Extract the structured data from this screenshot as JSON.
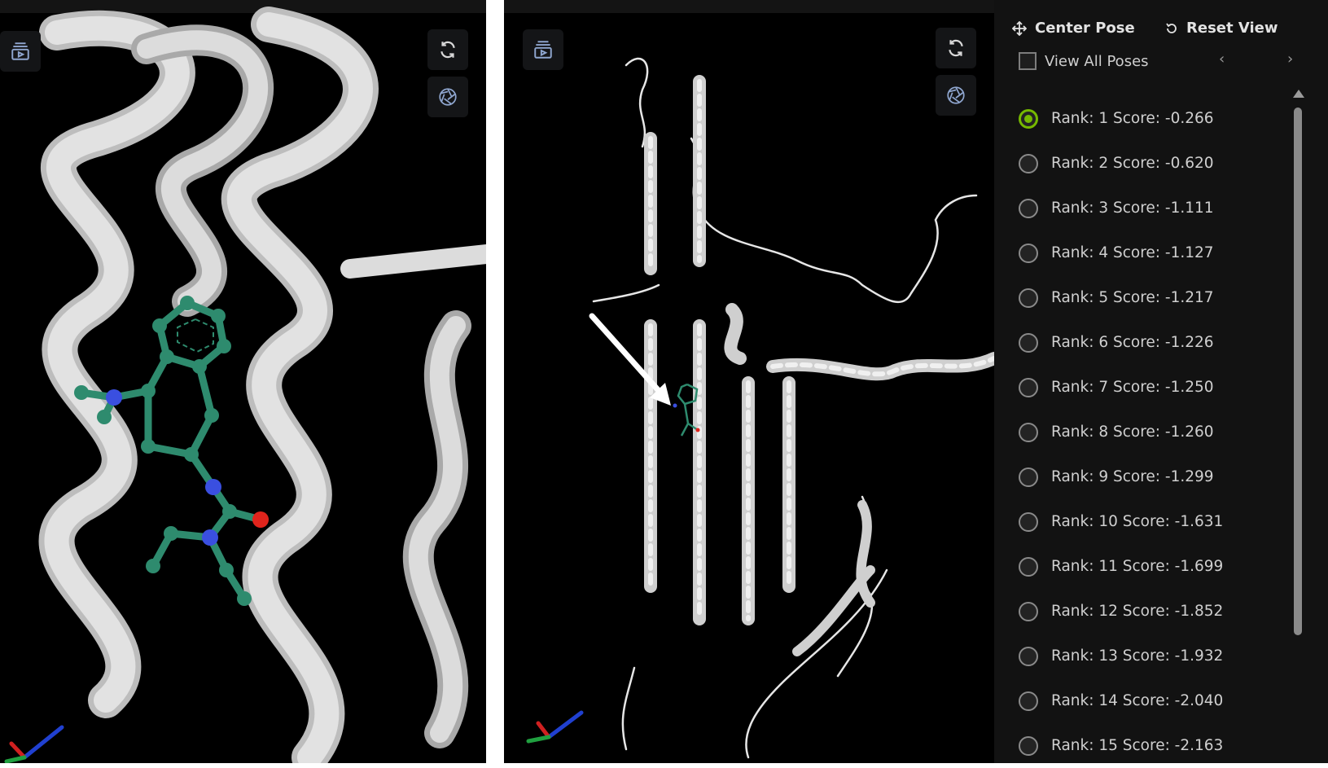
{
  "left_viewer": {
    "icons": [
      "playlist-icon",
      "rotate-icon",
      "aperture-icon"
    ]
  },
  "right_viewer": {
    "icons": [
      "playlist-icon",
      "rotate-icon",
      "aperture-icon"
    ],
    "annotation": "white-arrow"
  },
  "side_panel": {
    "center_pose_label": "Center Pose",
    "reset_view_label": "Reset View",
    "view_all_label": "View All Poses",
    "prev_label": "‹",
    "next_label": "›",
    "poses": [
      {
        "label": "Rank: 1 Score: -0.266",
        "selected": true
      },
      {
        "label": "Rank: 2 Score: -0.620",
        "selected": false
      },
      {
        "label": "Rank: 3 Score: -1.111",
        "selected": false
      },
      {
        "label": "Rank: 4 Score: -1.127",
        "selected": false
      },
      {
        "label": "Rank: 5 Score: -1.217",
        "selected": false
      },
      {
        "label": "Rank: 6 Score: -1.226",
        "selected": false
      },
      {
        "label": "Rank: 7 Score: -1.250",
        "selected": false
      },
      {
        "label": "Rank: 8 Score: -1.260",
        "selected": false
      },
      {
        "label": "Rank: 9 Score: -1.299",
        "selected": false
      },
      {
        "label": "Rank: 10 Score: -1.631",
        "selected": false
      },
      {
        "label": "Rank: 11 Score: -1.699",
        "selected": false
      },
      {
        "label": "Rank: 12 Score: -1.852",
        "selected": false
      },
      {
        "label": "Rank: 13 Score: -1.932",
        "selected": false
      },
      {
        "label": "Rank: 14 Score: -2.040",
        "selected": false
      },
      {
        "label": "Rank: 15 Score: -2.163",
        "selected": false
      }
    ]
  },
  "colors": {
    "ribbon": "#d0d0d0",
    "ligand": "#2e8b6e",
    "nitrogen": "#3a4fe0",
    "oxygen": "#e0241c",
    "accent": "#76b900"
  }
}
